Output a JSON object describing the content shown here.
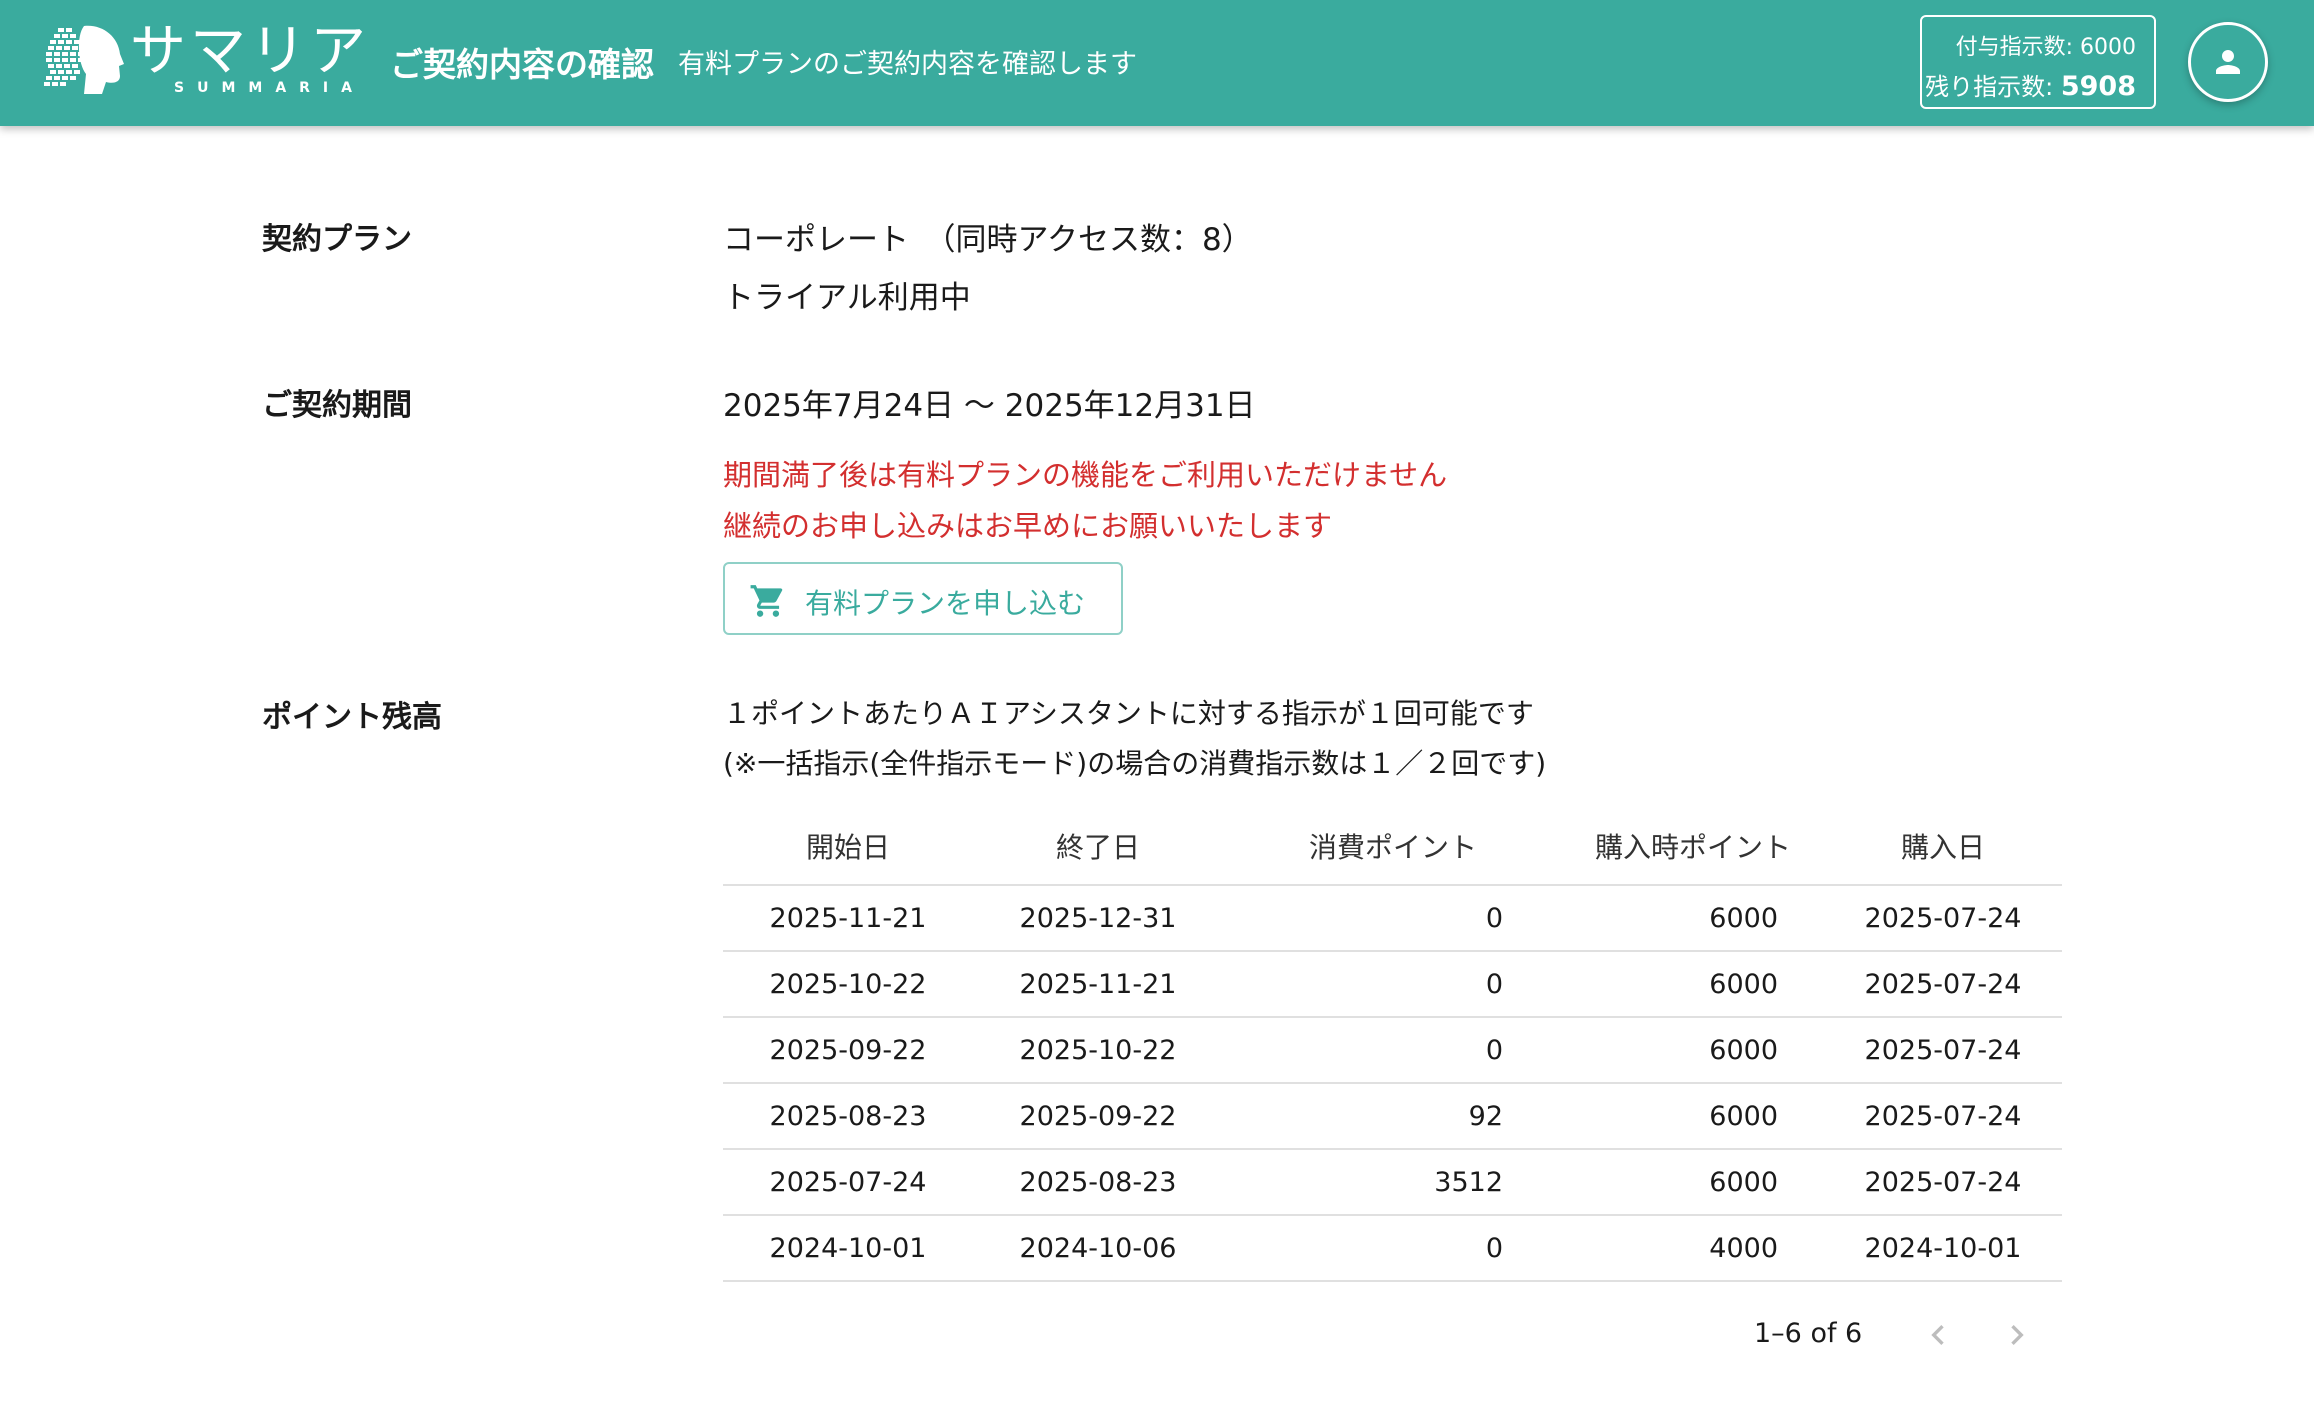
{
  "header": {
    "logo_text": "サマリア",
    "logo_sub": "SUMMARIA",
    "title": "ご契約内容の確認",
    "subtitle": "有料プランのご契約内容を確認します",
    "granted_label": "付与指示数: 6000",
    "remaining_label": "残り指示数:",
    "remaining_value": "5908"
  },
  "plan": {
    "label": "契約プラン",
    "name": "コーポレート　（同時アクセス数：8）",
    "status": "トライアル利用中"
  },
  "period": {
    "label": "ご契約期間",
    "range": "2025年7月24日 〜 2025年12月31日",
    "warning1": "期間満了後は有料プランの機能をご利用いただけません",
    "warning2": "継続のお申し込みはお早めにお願いいたします",
    "apply_button": "有料プランを申し込む"
  },
  "points": {
    "label": "ポイント残高",
    "note1": "１ポイントあたりＡＩアシスタントに対する指示が１回可能です",
    "note2": "(※一括指示(全件指示モード)の場合の消費指示数は１／２回です)"
  },
  "table": {
    "headers": [
      "開始日",
      "終了日",
      "消費ポイント",
      "購入時ポイント",
      "購入日"
    ],
    "rows": [
      [
        "2025-11-21",
        "2025-12-31",
        "0",
        "6000",
        "2025-07-24"
      ],
      [
        "2025-10-22",
        "2025-11-21",
        "0",
        "6000",
        "2025-07-24"
      ],
      [
        "2025-09-22",
        "2025-10-22",
        "0",
        "6000",
        "2025-07-24"
      ],
      [
        "2025-08-23",
        "2025-09-22",
        "92",
        "6000",
        "2025-07-24"
      ],
      [
        "2025-07-24",
        "2025-08-23",
        "3512",
        "6000",
        "2025-07-24"
      ],
      [
        "2024-10-01",
        "2024-10-06",
        "0",
        "4000",
        "2024-10-01"
      ]
    ]
  },
  "pager": {
    "text": "1–6 of 6"
  },
  "colors": {
    "brand": "#3aab9e",
    "warning": "#d32f2f"
  },
  "icons": {
    "cart": "shopping-cart-icon",
    "avatar": "person-icon",
    "prev": "chevron-left-icon",
    "next": "chevron-right-icon"
  }
}
